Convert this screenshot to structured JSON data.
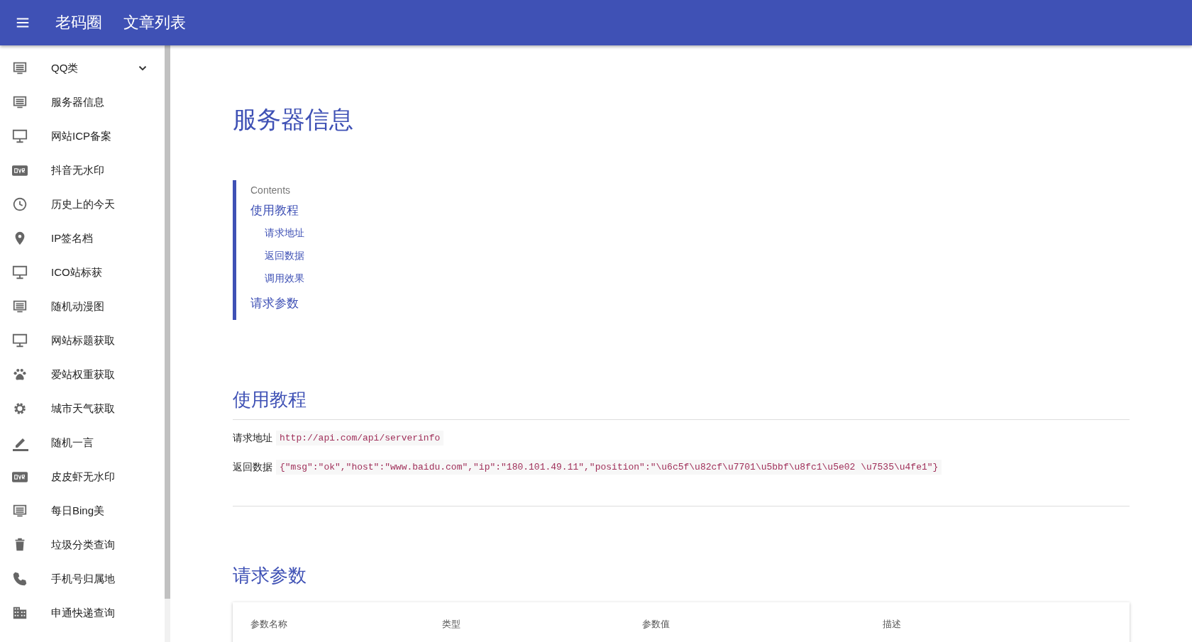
{
  "app_bar": {
    "brand": "老码圈",
    "title": "文章列表"
  },
  "sidebar": {
    "items": [
      {
        "label": "QQ类",
        "kind": "group",
        "expanded": false
      },
      {
        "label": "服务器信息",
        "kind": "link"
      },
      {
        "label": "网站ICP备案",
        "kind": "link"
      },
      {
        "label": "抖音无水印",
        "kind": "link"
      },
      {
        "label": "历史上的今天",
        "kind": "link"
      },
      {
        "label": "IP签名档",
        "kind": "link"
      },
      {
        "label": "ICO站标获",
        "kind": "link"
      },
      {
        "label": "随机动漫图",
        "kind": "link"
      },
      {
        "label": "网站标题获取",
        "kind": "link"
      },
      {
        "label": "爱站权重获取",
        "kind": "link"
      },
      {
        "label": "城市天气获取",
        "kind": "link"
      },
      {
        "label": "随机一言",
        "kind": "link"
      },
      {
        "label": "皮皮虾无水印",
        "kind": "link"
      },
      {
        "label": "每日Bing美",
        "kind": "link"
      },
      {
        "label": "垃圾分类查询",
        "kind": "link"
      },
      {
        "label": "手机号归属地",
        "kind": "link"
      },
      {
        "label": "申通快递查询",
        "kind": "link"
      }
    ]
  },
  "page": {
    "title": "服务器信息",
    "contents": {
      "heading": "Contents",
      "entries": [
        {
          "label": "使用教程",
          "children": [
            {
              "label": "请求地址"
            },
            {
              "label": "返回数据"
            },
            {
              "label": "调用效果"
            }
          ]
        },
        {
          "label": "请求参数"
        }
      ]
    },
    "tutorial": {
      "heading": "使用教程",
      "fields": [
        {
          "label": "请求地址",
          "code": "http://api.com/api/serverinfo"
        },
        {
          "label": "返回数据",
          "code": "{\"msg\":\"ok\",\"host\":\"www.baidu.com\",\"ip\":\"180.101.49.11\",\"position\":\"\\u6c5f\\u82cf\\u7701\\u5bbf\\u8fc1\\u5e02 \\u7535\\u4fe1\"}"
        }
      ]
    },
    "params": {
      "heading": "请求参数",
      "columns": [
        "参数名称",
        "类型",
        "参数值",
        "描述"
      ]
    }
  }
}
